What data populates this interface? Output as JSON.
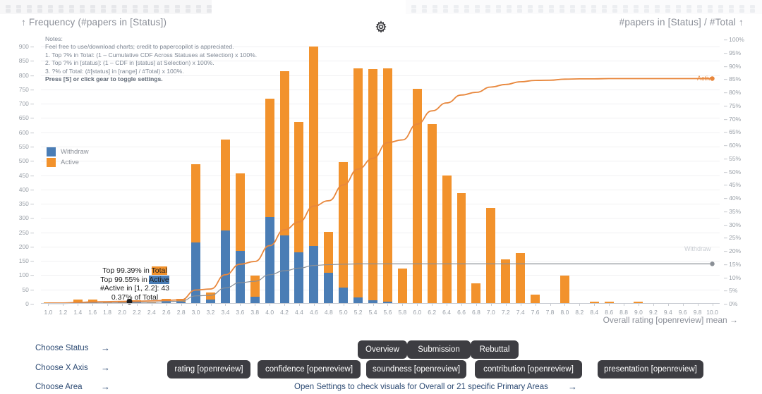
{
  "header": {
    "left_title": "↑ Frequency (#papers in [Status])",
    "right_title": "#papers in [Status] / #Total ↑",
    "gear_icon": "gear-icon"
  },
  "notes": {
    "title": "Notes:",
    "line1": "Feel free to use/download charts; credit to papercopilot is appreciated.",
    "line2": "1. Top ?% in Total: (1 – Cumulative CDF Across Statuses at Selection) x 100%.",
    "line3": "2. Top ?% in [status]: (1 – CDF in [status] at Selection) x 100%.",
    "line4": "3. ?% of Total: (#[status] in [range] / #Total) x 100%.",
    "line5": "Press [S] or click gear to toggle settings."
  },
  "legend": {
    "items": [
      {
        "label": "Withdraw",
        "color": "#4a7db5"
      },
      {
        "label": "Active",
        "color": "#f2922c"
      }
    ]
  },
  "annotation": {
    "line1_pre": "Top 99.39% in ",
    "line1_hl": "Total",
    "line2_pre": "Top 99.55% in ",
    "line2_hl": "Active",
    "line3": "#Active in [1, 2.2]: 43",
    "line4": "0.37% of Total"
  },
  "curve_labels": {
    "active": "Active",
    "withdraw": "Withdraw"
  },
  "axis_titles": {
    "x": "Overall rating [openreview] mean →"
  },
  "controls": {
    "rows": [
      {
        "label": "Choose Status",
        "arrow": "→"
      },
      {
        "label": "Choose X Axis",
        "arrow": "→"
      },
      {
        "label": "Choose Area",
        "arrow": "→"
      }
    ],
    "status_buttons": [
      "Overview",
      "Submission",
      "Rebuttal"
    ],
    "xaxis_buttons": [
      "rating [openreview]",
      "confidence [openreview]",
      "soundness [openreview]",
      "contribution [openreview]",
      "presentation [openreview]"
    ],
    "area_hint": "Open Settings to check visuals for Overall or 21 specific Primary Areas",
    "area_hint_arrow": "→"
  },
  "chart_data": {
    "type": "bar",
    "title": "",
    "xlabel": "Overall rating [openreview] mean →",
    "ylabel": "Frequency (#papers in [Status])",
    "y2label": "#papers in [Status] / #Total",
    "ylim": [
      0,
      925
    ],
    "y2lim": [
      0,
      100
    ],
    "xlim": [
      0.9,
      10.1
    ],
    "grid": true,
    "legend_position": "inner-left",
    "yticks": [
      0,
      50,
      100,
      150,
      200,
      250,
      300,
      350,
      400,
      450,
      500,
      550,
      600,
      650,
      700,
      750,
      800,
      850,
      900
    ],
    "y2ticks": [
      "0%",
      "5%",
      "10%",
      "15%",
      "20%",
      "25%",
      "30%",
      "35%",
      "40%",
      "45%",
      "50%",
      "55%",
      "60%",
      "65%",
      "70%",
      "75%",
      "80%",
      "85%",
      "90%",
      "95%",
      "100%"
    ],
    "categories": [
      "1.0",
      "1.2",
      "1.4",
      "1.6",
      "1.8",
      "2.0",
      "2.2",
      "2.4",
      "2.6",
      "2.8",
      "3.0",
      "3.2",
      "3.4",
      "3.6",
      "3.8",
      "4.0",
      "4.2",
      "4.4",
      "4.6",
      "4.8",
      "5.0",
      "5.2",
      "5.4",
      "5.6",
      "5.8",
      "6.0",
      "6.2",
      "6.4",
      "6.6",
      "6.8",
      "7.0",
      "7.2",
      "7.4",
      "7.6",
      "7.8",
      "8.0",
      "8.2",
      "8.4",
      "8.6",
      "8.8",
      "9.0",
      "9.2",
      "9.4",
      "9.6",
      "9.8",
      "10.0"
    ],
    "series": [
      {
        "name": "Withdraw",
        "color": "#4a7db5",
        "values": [
          0,
          0,
          2,
          3,
          0,
          2,
          4,
          0,
          8,
          6,
          212,
          12,
          253,
          182,
          22,
          300,
          238,
          178,
          200,
          106,
          54,
          20,
          10,
          5,
          0,
          0,
          0,
          0,
          0,
          0,
          0,
          0,
          0,
          0,
          0,
          0,
          0,
          0,
          0,
          0,
          0,
          0,
          0,
          0,
          0,
          0
        ]
      },
      {
        "name": "Active",
        "color": "#f2922c",
        "values": [
          2,
          0,
          10,
          10,
          2,
          4,
          6,
          2,
          8,
          8,
          274,
          26,
          319,
          272,
          75,
          416,
          574,
          455,
          698,
          142,
          440,
          801,
          810,
          817,
          122,
          749,
          626,
          447,
          386,
          68,
          332,
          152,
          176,
          30,
          0,
          97,
          0,
          4,
          5,
          0,
          4,
          0,
          0,
          0,
          0,
          0
        ]
      }
    ],
    "totals": [
      2,
      0,
      12,
      13,
      2,
      6,
      10,
      2,
      16,
      14,
      486,
      38,
      572,
      454,
      97,
      716,
      812,
      633,
      898,
      248,
      494,
      821,
      820,
      822,
      122,
      749,
      626,
      447,
      386,
      68,
      332,
      152,
      176,
      30,
      0,
      97,
      0,
      4,
      5,
      0,
      4,
      0,
      0,
      0,
      0,
      0
    ],
    "lines": [
      {
        "name": "Active",
        "color": "#e8873c",
        "type": "cumulative-percent",
        "values": [
          0.3,
          0.3,
          0.5,
          0.7,
          0.8,
          0.9,
          1.0,
          1.1,
          1.3,
          1.5,
          5.2,
          5.6,
          11.0,
          15.0,
          16.0,
          22.0,
          28.0,
          31.0,
          37.0,
          39.0,
          45.0,
          51.0,
          55.0,
          61.0,
          62.0,
          68.0,
          73.0,
          76.0,
          79.0,
          80.0,
          82.0,
          83.0,
          84.0,
          84.5,
          84.6,
          85.0,
          85.1,
          85.1,
          85.2,
          85.2,
          85.2,
          85.2,
          85.2,
          85.2,
          85.2,
          85.2
        ],
        "end_value": 85.2
      },
      {
        "name": "Withdraw",
        "color": "#8a8f96",
        "type": "cumulative-percent",
        "values": [
          0.1,
          0.1,
          0.2,
          0.3,
          0.3,
          0.4,
          0.5,
          0.5,
          0.8,
          1.0,
          3.0,
          3.2,
          6.0,
          8.0,
          8.5,
          11.0,
          12.5,
          13.5,
          14.5,
          14.8,
          15.0,
          15.1,
          15.1,
          15.1,
          15.1,
          15.1,
          15.1,
          15.1,
          15.1,
          15.1,
          15.1,
          15.1,
          15.1,
          15.1,
          15.1,
          15.1,
          15.1,
          15.1,
          15.1,
          15.1,
          15.1,
          15.1,
          15.1,
          15.1,
          15.1,
          15.1
        ],
        "end_value": 15.1
      }
    ],
    "selection_marker": {
      "x": 2.1,
      "y": 0,
      "color": "#1c1c1c"
    }
  }
}
